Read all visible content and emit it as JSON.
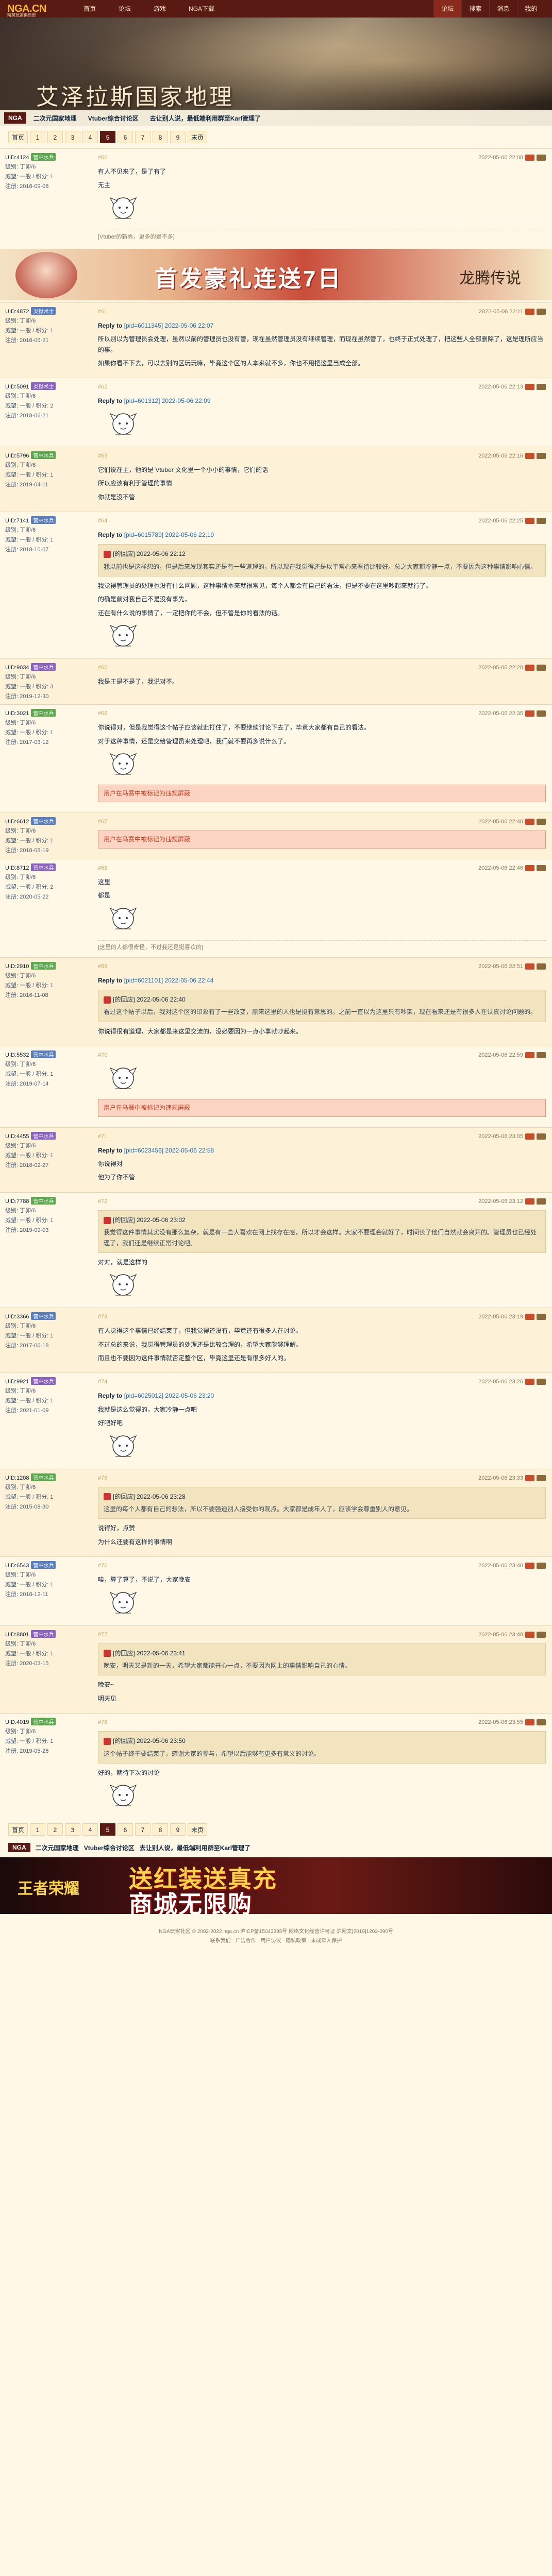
{
  "header": {
    "logo_text": "NGA.CN",
    "logo_sub": "精英玩家俱乐部",
    "nav": [
      "首页",
      "论坛",
      "游戏",
      "NGA下载"
    ],
    "right_nav": [
      "论坛",
      "搜索",
      "消息",
      "我的"
    ]
  },
  "banner": {
    "title": "艾泽拉斯国家地理",
    "home_label": "NGA",
    "forum_tabs": [
      "二次元国家地理",
      "Vtuber综合讨论区",
      "去让别人说，最低端利用群至Karl管理了"
    ]
  },
  "pager_top": {
    "pages": [
      "首页",
      "1",
      "2",
      "3",
      "4",
      "5",
      "6",
      "7",
      "8",
      "9",
      "末页"
    ],
    "current": "5"
  },
  "posts": [
    {
      "uid": "UID:4124",
      "tag": "营中水兵",
      "level": "级别: 丁卯/6",
      "rep": "威望: 一般 / 积分: 1",
      "reg": "注册: 2018-09-08",
      "floor": "#60",
      "time": "2022-05-06 22:08",
      "body": [
        "有人不见来了，是了有了",
        "无主"
      ],
      "sig": "[Vtuber的新秀，更多的是不多]"
    },
    {
      "uid": "UID:4872",
      "tag": "炎狱术士",
      "level": "级别: 丁卯/6",
      "rep": "威望: 一般 / 积分: 1",
      "reg": "注册: 2018-06-21",
      "floor": "#61",
      "time": "2022-05-06 22:11",
      "reply_prefix": "Reply to",
      "reply_target": "[pid=6011345] 2022-05-06 22:07",
      "body": [
        "所以别以为管理员会处理，虽然以前的管理员也没有管，现在虽然管理员没有继续管理，而现在虽然管了，也终于正式处理了，把这些人全部删除了，这是理所应当的事。",
        "如果你看不下去，可以去别的区玩玩嘛，毕竟这个区的人本来就不多，你也不用把这里当成全部。"
      ]
    },
    {
      "uid": "UID:5091",
      "tag": "炎狱术士",
      "level": "级别: 丁卯/6",
      "rep": "威望: 一般 / 积分: 2",
      "reg": "注册: 2018-06-21",
      "floor": "#62",
      "time": "2022-05-06 22:13",
      "reply_prefix": "Reply to",
      "reply_target": "[pid=601312] 2022-05-06 22:09",
      "body": []
    },
    {
      "uid": "UID:5796",
      "tag": "营中水兵",
      "level": "级别: 丁卯/6",
      "rep": "威望: 一般 / 积分: 1",
      "reg": "注册: 2019-04-11",
      "floor": "#63",
      "time": "2022-05-06 22:16",
      "body": [
        "它们说在主，他的是 Vtuber 文化里一个小小的事情，它们的话",
        "所以应该有利于管理的事情"
      ],
      "extra": "你就是没不管"
    },
    {
      "uid": "UID:7141",
      "tag": "营中水兵",
      "level": "级别: 丁卯/6",
      "rep": "威望: 一般 / 积分: 1",
      "reg": "注册: 2018-10-07",
      "floor": "#64",
      "time": "2022-05-06 22:25",
      "reply_prefix": "Reply to",
      "reply_target": "[pid=6015789] 2022-05-06 22:19",
      "body": [
        "我觉得管理员的处理也没有什么问题，这种事情本来就很常见，每个人都会有自己的看法，但是不要在这里吵起来就行了。",
        "的确是前对我自己不是没有事先，",
        "还在有什么说的事情了，一定把你的不会，但不管是你的看法的话。"
      ],
      "quote_head": "[的回应] 2022-05-06 22:12",
      "quote": "我以前也是这样想的，但是后来发现其实还是有一些道理的，所以现在我觉得还是以平常心来看待比较好。总之大家都冷静一点，不要因为这种事情影响心情。"
    },
    {
      "uid": "UID:9034",
      "tag": "营中水兵",
      "level": "级别: 丁卯/6",
      "rep": "威望: 一般 / 积分: 3",
      "reg": "注册: 2019-12-30",
      "floor": "#65",
      "time": "2022-05-06 22:28",
      "body": [
        "我是主是不是了，我说对不。"
      ]
    },
    {
      "uid": "UID:3021",
      "tag": "营中水兵",
      "level": "级别: 丁卯/6",
      "rep": "威望: 一般 / 积分: 1",
      "reg": "注册: 2017-03-12",
      "floor": "#66",
      "time": "2022-05-06 22:35",
      "body": [
        "你说得对，但是我觉得这个帖子应该就此打住了，不要继续讨论下去了，毕竟大家都有自己的看法。",
        "对于这种事情，还是交给管理员来处理吧，我们就不要再多说什么了。"
      ],
      "notice": "用户在马赛中被标记为违规屏蔽"
    },
    {
      "uid": "UID:6612",
      "tag": "营中水兵",
      "level": "级别: 丁卯/6",
      "rep": "威望: 一般 / 积分: 1",
      "reg": "注册: 2018-08-19",
      "floor": "#67",
      "time": "2022-05-06 22:40",
      "body": [],
      "notice": "用户在马赛中被标记为违规屏蔽"
    },
    {
      "uid": "UID:8712",
      "tag": "营中水兵",
      "level": "级别: 丁卯/6",
      "rep": "威望: 一般 / 积分: 2",
      "reg": "注册: 2020-05-22",
      "floor": "#68",
      "time": "2022-05-06 22:46",
      "body": [
        "这里",
        "都是"
      ],
      "sig": "[这里的人都很奇怪，不过我还是挺喜欢的]"
    },
    {
      "uid": "UID:2910",
      "tag": "营中水兵",
      "level": "级别: 丁卯/6",
      "rep": "威望: 一般 / 积分: 1",
      "reg": "注册: 2016-11-08",
      "floor": "#69",
      "time": "2022-05-06 22:51",
      "reply_prefix": "Reply to",
      "reply_target": "[pid=6021101] 2022-05-06 22:44",
      "quote_head": "[的回应] 2022-05-06 22:40",
      "quote": "看过这个帖子以后，我对这个区的印象有了一些改变，原来这里的人也是挺有意思的。之前一直以为这里只有吵架，现在看来还是有很多人在认真讨论问题的。",
      "body": [
        "你说得很有道理，大家都是来这里交流的，没必要因为一点小事就吵起来。"
      ]
    },
    {
      "uid": "UID:5532",
      "tag": "营中水兵",
      "level": "级别: 丁卯/6",
      "rep": "威望: 一般 / 积分: 1",
      "reg": "注册: 2019-07-14",
      "floor": "#70",
      "time": "2022-05-06 22:59",
      "body": [],
      "notice": "用户在马赛中被标记为违规屏蔽"
    },
    {
      "uid": "UID:4455",
      "tag": "营中水兵",
      "level": "级别: 丁卯/6",
      "rep": "威望: 一般 / 积分: 1",
      "reg": "注册: 2018-02-27",
      "floor": "#71",
      "time": "2022-05-06 23:05",
      "reply_prefix": "Reply to",
      "reply_target": "[pid=6023456] 2022-05-06 22:58",
      "body": [
        "你说得对",
        "他为了你不管"
      ]
    },
    {
      "uid": "UID:7788",
      "tag": "营中水兵",
      "level": "级别: 丁卯/6",
      "rep": "威望: 一般 / 积分: 1",
      "reg": "注册: 2019-09-03",
      "floor": "#72",
      "time": "2022-05-06 23:12",
      "quote_head": "[的回应] 2022-05-06 23:02",
      "quote": "我觉得这件事情其实没有那么复杂，就是有一些人喜欢在网上找存在感，所以才会这样。大家不要理会就好了，时间长了他们自然就会离开的。管理员也已经处理了，我们还是继续正常讨论吧。",
      "body": [
        "对对，就是这样的"
      ]
    },
    {
      "uid": "UID:3366",
      "tag": "营中水兵",
      "level": "级别: 丁卯/6",
      "rep": "威望: 一般 / 积分: 1",
      "reg": "注册: 2017-06-18",
      "floor": "#73",
      "time": "2022-05-06 23:19",
      "body": [
        "有人觉得这个事情已经结束了，但我觉得还没有，毕竟还有很多人在讨论。",
        "不过总的来说，我觉得管理员的处理还是比较合理的，希望大家能够理解。",
        "而且也不要因为这件事情就否定整个区，毕竟这里还是有很多好人的。"
      ]
    },
    {
      "uid": "UID:9921",
      "tag": "营中水兵",
      "level": "级别: 丁卯/6",
      "rep": "威望: 一般 / 积分: 1",
      "reg": "注册: 2021-01-09",
      "floor": "#74",
      "time": "2022-05-06 23:26",
      "reply_prefix": "Reply to",
      "reply_target": "[pid=6025012] 2022-05-06 23:20",
      "body": [
        "我就是这么觉得的，大家冷静一点吧",
        "好吧好吧"
      ]
    },
    {
      "uid": "UID:1208",
      "tag": "营中水兵",
      "level": "级别: 丁卯/6",
      "rep": "威望: 一般 / 积分: 1",
      "reg": "注册: 2015-08-30",
      "floor": "#75",
      "time": "2022-05-06 23:33",
      "quote_head": "[的回应] 2022-05-06 23:28",
      "quote": "这里的每个人都有自己的想法，所以不要强迫别人接受你的观点。大家都是成年人了，应该学会尊重别人的意见。",
      "body": [
        "说得好，点赞",
        "为什么还要有这样的事情啊"
      ]
    },
    {
      "uid": "UID:6543",
      "tag": "营中水兵",
      "level": "级别: 丁卯/6",
      "rep": "威望: 一般 / 积分: 1",
      "reg": "注册: 2018-12-11",
      "floor": "#76",
      "time": "2022-05-06 23:40",
      "body": [
        "唉，算了算了，不说了，大家晚安"
      ]
    },
    {
      "uid": "UID:8801",
      "tag": "营中水兵",
      "level": "级别: 丁卯/6",
      "rep": "威望: 一般 / 积分: 1",
      "reg": "注册: 2020-03-15",
      "floor": "#77",
      "time": "2022-05-06 23:48",
      "quote_head": "[的回应] 2022-05-06 23:41",
      "quote": "晚安，明天又是新的一天，希望大家都能开心一点，不要因为网上的事情影响自己的心情。",
      "body": [
        "晚安~",
        "明天见"
      ]
    },
    {
      "uid": "UID:4019",
      "tag": "营中水兵",
      "level": "级别: 丁卯/6",
      "rep": "威望: 一般 / 积分: 1",
      "reg": "注册: 2019-05-26",
      "floor": "#78",
      "time": "2022-05-06 23:55",
      "quote_head": "[的回应] 2022-05-06 23:50",
      "quote": "这个帖子终于要结束了，感谢大家的参与，希望以后能够有更多有意义的讨论。",
      "body": [
        "好的，期待下次的讨论"
      ]
    }
  ],
  "ads": {
    "ad1_text": "首发豪礼连送7日",
    "ad1_brand": "龙腾传说",
    "ad2_logo": "王者荣耀",
    "ad2_line1": "送红装送真充",
    "ad2_line2": "商城无限购"
  },
  "footer": {
    "line1": "NGA玩家社区 © 2002-2022 nga.cn  沪ICP备15043395号  网络文化经营许可证 沪网文[2019]1203-090号",
    "line2": "联系我们 · 广告合作 · 用户协议 · 隐私政策 · 未成年人保护"
  }
}
